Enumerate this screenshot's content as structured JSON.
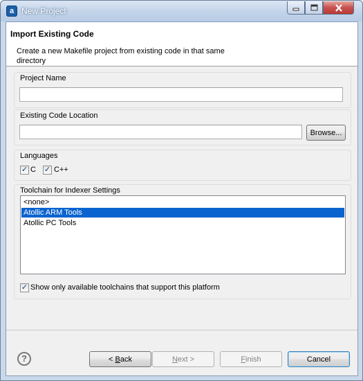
{
  "window": {
    "title": "New Project",
    "icon_letter": "a",
    "accent_color": "#0a64cf"
  },
  "header": {
    "title": "Import Existing Code",
    "description": "Create a new Makefile project from existing code in that same directory"
  },
  "project_name": {
    "label": "Project Name",
    "value": ""
  },
  "code_location": {
    "label": "Existing Code Location",
    "value": "",
    "browse_label": "Browse..."
  },
  "languages": {
    "label": "Languages",
    "c_label": "C",
    "c_checked": true,
    "cpp_label": "C++",
    "cpp_checked": true
  },
  "toolchain": {
    "label": "Toolchain for Indexer Settings",
    "items": [
      "<none>",
      "Atollic ARM Tools",
      "Atollic PC Tools"
    ],
    "selected_index": 1,
    "filter_label": "Show only available toolchains that support this platform",
    "filter_checked": true
  },
  "footer": {
    "back_prefix": "< ",
    "back_mnemonic": "B",
    "back_rest": "ack",
    "next_mnemonic": "N",
    "next_rest": "ext >",
    "finish_mnemonic": "F",
    "finish_rest": "inish",
    "cancel_label": "Cancel",
    "help_icon": "question-mark-icon"
  }
}
